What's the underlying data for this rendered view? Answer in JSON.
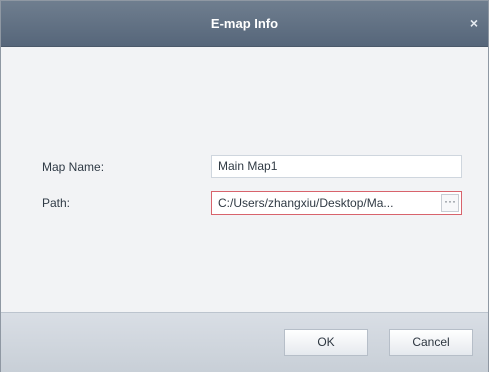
{
  "dialog": {
    "title": "E-map Info",
    "close_icon": "×"
  },
  "form": {
    "map_name_label": "Map Name:",
    "map_name_value": "Main Map1",
    "path_label": "Path:",
    "path_value": "C:/Users/zhangxiu/Desktop/Ma...",
    "browse_label": "···"
  },
  "footer": {
    "ok_label": "OK",
    "cancel_label": "Cancel"
  },
  "colors": {
    "titlebar": "#5f6f82",
    "path_border_error": "#d8636c"
  }
}
